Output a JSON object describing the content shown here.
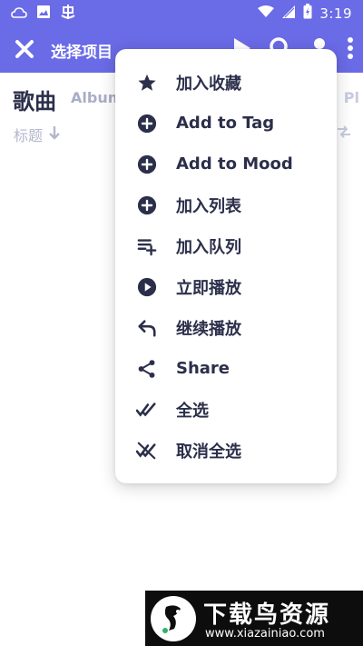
{
  "statusbar": {
    "time": "3:19"
  },
  "toolbar": {
    "title": "选择项目"
  },
  "tabs": {
    "songs": "歌曲",
    "albums": "Album",
    "playlists": "Pl"
  },
  "sort": {
    "label": "标题"
  },
  "menu": {
    "items": [
      {
        "label": "加入收藏",
        "icon": "star-icon"
      },
      {
        "label": "Add to Tag",
        "icon": "plus-circle-icon"
      },
      {
        "label": "Add to Mood",
        "icon": "plus-circle-icon"
      },
      {
        "label": "加入列表",
        "icon": "plus-circle-icon"
      },
      {
        "label": "加入队列",
        "icon": "queue-add-icon"
      },
      {
        "label": "立即播放",
        "icon": "play-circle-icon"
      },
      {
        "label": "继续播放",
        "icon": "reply-icon"
      },
      {
        "label": "Share",
        "icon": "share-icon"
      },
      {
        "label": "全选",
        "icon": "double-check-icon"
      },
      {
        "label": "取消全选",
        "icon": "deselect-all-icon"
      }
    ]
  },
  "watermark": {
    "title": "下载鸟资源",
    "url": "www.xiazainiao.com"
  },
  "colors": {
    "accent": "#6a6be6",
    "text": "#2b2f4a",
    "muted": "#b3b7cc"
  }
}
